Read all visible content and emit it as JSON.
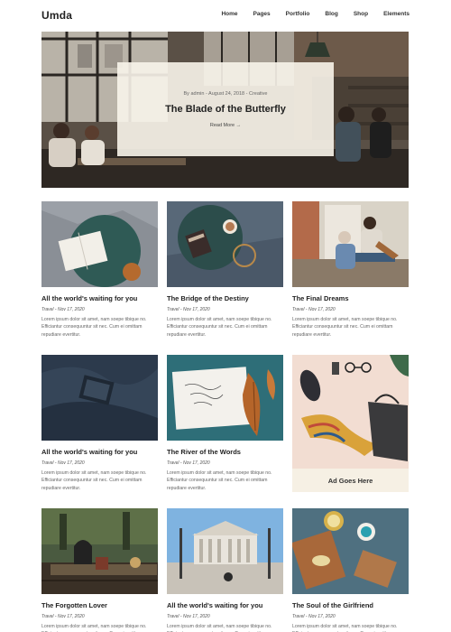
{
  "site": {
    "logo": "Umda"
  },
  "nav": [
    "Home",
    "Pages",
    "Portfolio",
    "Blog",
    "Shop",
    "Elements"
  ],
  "hero": {
    "meta": "By admin - August 24, 2018 - Creative",
    "title": "The Blade of the Butterfly",
    "read_more": "Read More →"
  },
  "cards": [
    {
      "title": "All the world's waiting for you",
      "meta": "Travel - Nov 17, 2020",
      "excerpt": "Lorem ipsum dolor sit amet, nam soepe tibique no. Efficiantur consequuntur sit nec. Cum ei omittam repudiare evertitur."
    },
    {
      "title": "The Bridge of the Destiny",
      "meta": "Travel - Nov 17, 2020",
      "excerpt": "Lorem ipsum dolor sit amet, nam soepe tibique no. Efficiantur consequuntur sit nec. Cum ei omittam repudiare evertitur."
    },
    {
      "title": "The Final Dreams",
      "meta": "Travel - Nov 17, 2020",
      "excerpt": "Lorem ipsum dolor sit amet, nam soepe tibique no. Efficiantur consequuntur sit nec. Cum ei omittam repudiare evertitur."
    },
    {
      "title": "All the world's waiting for you",
      "meta": "Travel - Nov 17, 2020",
      "excerpt": "Lorem ipsum dolor sit amet, nam soepe tibique no. Efficiantur consequuntur sit nec. Cum ei omittam repudiare evertitur."
    },
    {
      "title": "The River of the Words",
      "meta": "Travel - Nov 17, 2020",
      "excerpt": "Lorem ipsum dolor sit amet, nam soepe tibique no. Efficiantur consequuntur sit nec. Cum ei omittam repudiare evertitur."
    },
    {
      "title": "The Forgotten Lover",
      "meta": "Travel - Nov 17, 2020",
      "excerpt": "Lorem ipsum dolor sit amet, nam soepe tibique no. Efficiantur consequuntur sit nec. Cum ei omittam repudiare evertitur."
    },
    {
      "title": "All the world's waiting for you",
      "meta": "Travel - Nov 17, 2020",
      "excerpt": "Lorem ipsum dolor sit amet, nam soepe tibique no. Efficiantur consequuntur sit nec. Cum ei omittam repudiare evertitur."
    },
    {
      "title": "The Soul of the Girlfriend",
      "meta": "Travel - Nov 17, 2020",
      "excerpt": "Lorem ipsum dolor sit amet, nam soepe tibique no. Efficiantur consequuntur sit nec. Cum ei omittam repudiare evertitur."
    }
  ],
  "ad": {
    "label": "Ad Goes Here"
  },
  "colors": {
    "accent": "#222222",
    "hero_card": "#f8f4ea",
    "ad_label_bg": "#f6f0e4",
    "text_muted": "#666666"
  }
}
